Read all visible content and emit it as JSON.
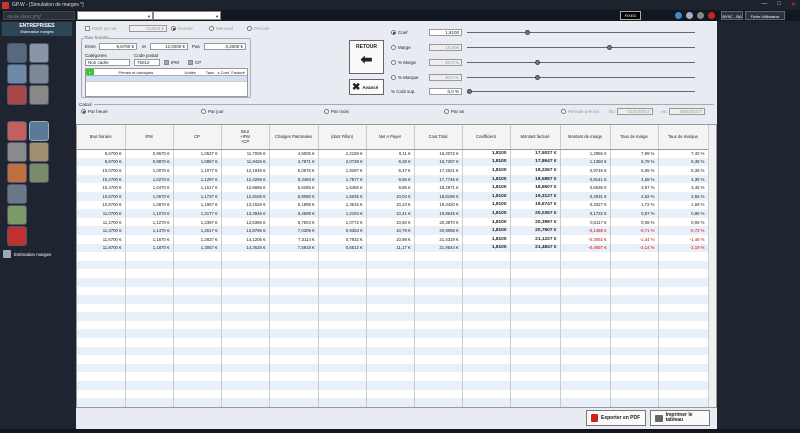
{
  "window": {
    "title": "GP.W - [Simulation de marges *]"
  },
  "topbar": {
    "access_placeholder": "Accès direct [F2]",
    "fixed_label": "FIXED",
    "bv_label": "BV9C - BA",
    "fiche_label": "Fiche Utilisateur"
  },
  "sidebar": {
    "section_title": "ENTREPRISES",
    "section_subtitle": "Estimation marges",
    "footer_label": "Estimation marges"
  },
  "params": {
    "partir_du_net": {
      "label": "Partir du net",
      "value": "0,0000 €"
    },
    "horaire_label": "Horaire",
    "mensuel_label": "Mensuel",
    "periode_label": "Période",
    "taux_horaire_label": "Taux horaire",
    "entre_label": "Entre",
    "entre_value": "9,6700 €",
    "et_label": "et",
    "et_value": "12,0000 €",
    "pas_label": "Pas",
    "pas_value": "0,2000 €",
    "categories_label": "Catégories",
    "categories_value": "Non cadre",
    "code_postal_label": "Code postal",
    "code_postal_value": "75012",
    "ipm_label": "IPM",
    "cp_label": "CP",
    "primes_header": [
      "",
      "Primes et rubriques",
      "Unités",
      "Taux",
      "x Coef",
      "Facturé"
    ],
    "retour_label": "RETOUR",
    "avance_label": "Avancé",
    "coef": {
      "label": "Coef",
      "value": "1,8100"
    },
    "marge": {
      "label": "Marge",
      "value": "10,00€"
    },
    "pct_marge": {
      "label": "% Marge",
      "value": "30,0 %"
    },
    "pct_marque": {
      "label": "% Marque",
      "value": "30,0 %"
    },
    "pct_cout_sup": {
      "label": "% Coût sup.",
      "value": "0,0 %"
    }
  },
  "calcul": {
    "label": "Calcul",
    "options": [
      "Par heure",
      "Par jour",
      "Par mois",
      "Par an",
      "Période précise"
    ],
    "du_label": "Du",
    "du_value": "01/03/2017",
    "au_label": "Au",
    "au_value": "26/03/2017"
  },
  "table": {
    "headers": [
      "Brut horaire",
      "IFM",
      "CP",
      "Brut\n+IFM\n+CP",
      "Charges Patronales",
      "(dont Fillon)",
      "Net A Payer",
      "Cout Total",
      "Coefficient",
      "Montant facturé",
      "Montant de marge",
      "Taux de marge",
      "Taux de marque"
    ],
    "rows": [
      [
        "9,6700 €",
        "0,9670 €",
        "1,0637 €",
        "11,7006 €",
        "4,5006 €",
        "2,2159 €",
        "9,11 €",
        "16,2072 €",
        "1,8100",
        "17,5027 €",
        "1,2955 €",
        "7,99 %",
        "7,40 %"
      ],
      [
        "9,8700 €",
        "0,9870 €",
        "1,0857 €",
        "11,9426 €",
        "4,7871 €",
        "2,0738 €",
        "9,28 €",
        "16,7297 €",
        "1,8100",
        "17,8647 €",
        "1,1350 €",
        "6,78 %",
        "6,35 %"
      ],
      [
        "10,0700 €",
        "1,0070 €",
        "1,1077 €",
        "12,1846 €",
        "5,0676 €",
        "1,9297 €",
        "9,47 €",
        "17,2521 €",
        "1,8100",
        "18,2267 €",
        "0,9746 €",
        "5,65 %",
        "5,35 %"
      ],
      [
        "10,2700 €",
        "1,0270 €",
        "1,1297 €",
        "12,4266 €",
        "5,3483 €",
        "1,7877 €",
        "9,66 €",
        "17,7746 €",
        "1,8100",
        "18,5887 €",
        "0,8141 €",
        "4,58 %",
        "4,38 %"
      ],
      [
        "10,4700 €",
        "1,0470 €",
        "1,1517 €",
        "12,6686 €",
        "5,6285 €",
        "1,6456 €",
        "9,85 €",
        "18,2971 €",
        "1,8100",
        "18,9507 €",
        "0,6536 €",
        "3,57 %",
        "3,45 %"
      ],
      [
        "10,6700 €",
        "1,0670 €",
        "1,1737 €",
        "12,9106 €",
        "5,9090 €",
        "1,5035 €",
        "10,04 €",
        "18,8196 €",
        "1,8100",
        "19,3127 €",
        "0,4931 €",
        "2,62 %",
        "2,55 %"
      ],
      [
        "10,8700 €",
        "1,0870 €",
        "1,1957 €",
        "13,1526 €",
        "6,1895 €",
        "1,3615 €",
        "10,23 €",
        "19,3420 €",
        "1,8100",
        "19,6747 €",
        "0,3327 €",
        "1,72 %",
        "1,69 %"
      ],
      [
        "11,0700 €",
        "1,1070 €",
        "1,2177 €",
        "13,3946 €",
        "6,4699 €",
        "1,2194 €",
        "10,41 €",
        "19,8645 €",
        "1,8100",
        "20,0367 €",
        "0,1722 €",
        "0,87 %",
        "0,86 %"
      ],
      [
        "11,2700 €",
        "1,1270 €",
        "1,2397 €",
        "13,6366 €",
        "6,7504 €",
        "1,0772 €",
        "10,60 €",
        "20,3870 €",
        "1,8100",
        "20,3987 €",
        "0,0117 €",
        "0,06 %",
        "0,06 %"
      ],
      [
        "11,4700 €",
        "1,1470 €",
        "1,2617 €",
        "13,8786 €",
        "7,0309 €",
        "0,9353 €",
        "10,79 €",
        "20,9095 €",
        "1,8100",
        "20,7607 €",
        "-0,1488 €",
        "-0,71 %",
        "-0,72 %"
      ],
      [
        "11,6700 €",
        "1,1670 €",
        "1,2837 €",
        "14,1206 €",
        "7,3114 €",
        "0,7932 €",
        "10,98 €",
        "21,4319 €",
        "1,8100",
        "21,1227 €",
        "-0,3092 €",
        "-1,44 %",
        "-1,46 %"
      ],
      [
        "11,8700 €",
        "1,1870 €",
        "1,3057 €",
        "14,3626 €",
        "7,5918 €",
        "0,6512 €",
        "11,17 €",
        "21,9544 €",
        "1,8100",
        "21,4847 €",
        "-0,4697 €",
        "-2,14 %",
        "-2,19 %"
      ]
    ]
  },
  "buttons": {
    "pdf_label": "Exporter en PDF",
    "print_label": "Imprimer le tableau"
  },
  "colors": {
    "negative": "#dd0000",
    "accent": "#2f4558"
  }
}
